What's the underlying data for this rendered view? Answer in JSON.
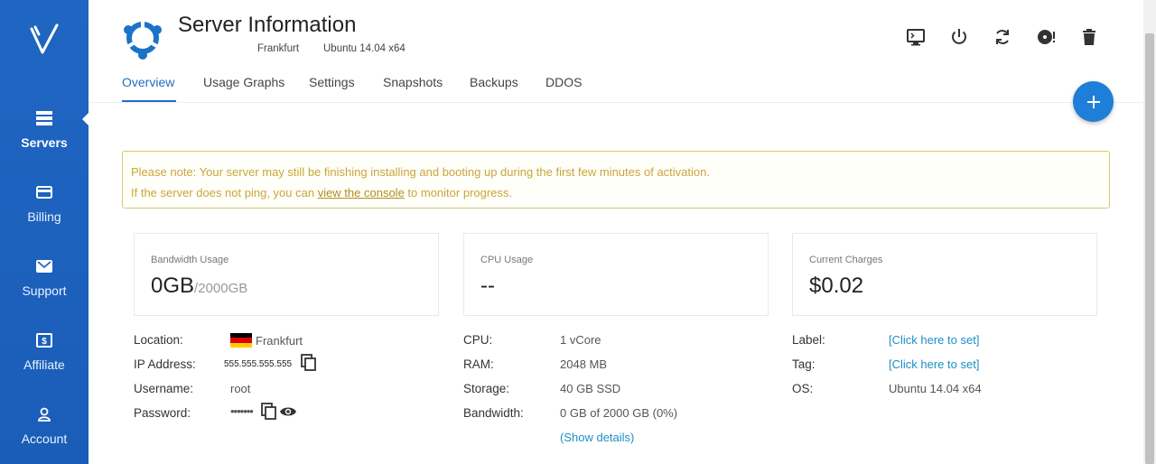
{
  "sidebar": {
    "logo_text": "V",
    "items": [
      {
        "label": "Servers",
        "icon": "servers-icon"
      },
      {
        "label": "Billing",
        "icon": "credit-card-icon"
      },
      {
        "label": "Support",
        "icon": "mail-icon"
      },
      {
        "label": "Affiliate",
        "icon": "dollar-icon"
      },
      {
        "label": "Account",
        "icon": "user-icon"
      }
    ],
    "background": "#1f66c2"
  },
  "header": {
    "title": "Server Information",
    "location": "Frankfurt",
    "os": "Ubuntu 14.04 x64",
    "toolbar": [
      "console-icon",
      "power-icon",
      "restart-icon",
      "reinstall-icon",
      "trash-icon"
    ]
  },
  "tabs": [
    {
      "label": "Overview",
      "active": true
    },
    {
      "label": "Usage Graphs"
    },
    {
      "label": "Settings"
    },
    {
      "label": "Snapshots"
    },
    {
      "label": "Backups"
    },
    {
      "label": "DDOS"
    }
  ],
  "notice": {
    "line1": "Please note: Your server may still be finishing installing and booting up during the first few minutes of activation.",
    "line2_before": "If the server does not ping, you can ",
    "line2_link": "view the console",
    "line2_after": " to monitor progress."
  },
  "cards": {
    "bandwidth": {
      "label": "Bandwidth Usage",
      "value": "0GB",
      "sub": "/2000GB"
    },
    "cpu": {
      "label": "CPU Usage",
      "value": "--"
    },
    "charges": {
      "label": "Current Charges",
      "value": "$0.02"
    }
  },
  "details_left": {
    "location_label": "Location:",
    "location_value": "Frankfurt",
    "ip_label": "IP Address:",
    "ip_value": "555.555.555.555",
    "username_label": "Username:",
    "username_value": "root",
    "password_label": "Password:",
    "password_value": "•••••••"
  },
  "details_mid": {
    "cpu_label": "CPU:",
    "cpu_value": "1 vCore",
    "ram_label": "RAM:",
    "ram_value": "2048 MB",
    "storage_label": "Storage:",
    "storage_value": "40 GB SSD",
    "bandwidth_label": "Bandwidth:",
    "bandwidth_value": "0 GB of 2000 GB (0%)",
    "show_details": "(Show details)"
  },
  "details_right": {
    "label_label": "Label:",
    "label_value": "[Click here to set]",
    "tag_label": "Tag:",
    "tag_value": "[Click here to set]",
    "os_label": "OS:",
    "os_value": "Ubuntu 14.04 x64"
  },
  "colors": {
    "accent": "#1f6fbf",
    "link": "#1d8fc6",
    "notice_text": "#c9a63a",
    "notice_border": "#d8c871",
    "fab": "#1f7fd8"
  }
}
